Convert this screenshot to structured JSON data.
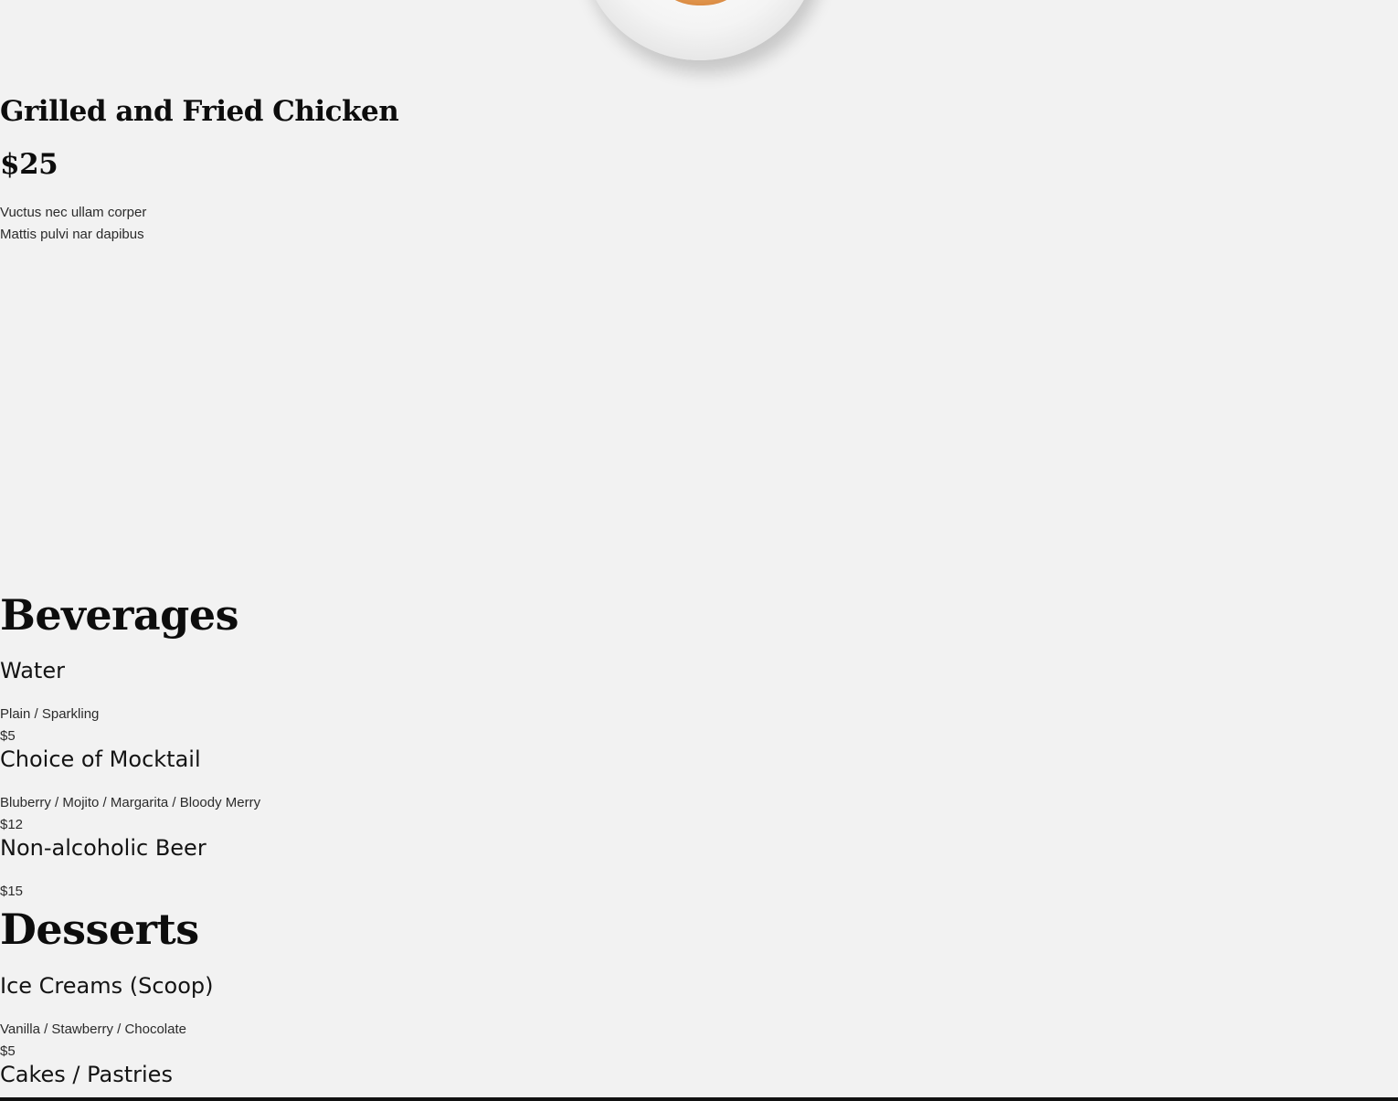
{
  "featured": {
    "image_icon": "plated-dish-image",
    "title": "Grilled and Fried Chicken",
    "price": "$25",
    "description_lines": [
      "Vuctus nec ullam corper",
      "Mattis pulvi nar dapibus"
    ]
  },
  "beverages": {
    "heading": "Beverages",
    "items": [
      {
        "name": "Water",
        "options": "Plain / Sparkling",
        "price": "$5"
      },
      {
        "name": "Choice of Mocktail",
        "options": "Bluberry / Mojito / Margarita / Bloody Merry",
        "price": "$12"
      },
      {
        "name": "Non-alcoholic Beer",
        "options": "",
        "price": "$15"
      }
    ]
  },
  "desserts": {
    "heading": "Desserts",
    "items": [
      {
        "name": "Ice Creams (Scoop)",
        "options": "Vanilla / Stawberry  / Chocolate",
        "price": "$5"
      },
      {
        "name": "Cakes / Pastries",
        "options": "",
        "price": ""
      }
    ]
  },
  "colors": {
    "background": "#f2f2f2",
    "text": "#111111",
    "bottom_bar": "#111111"
  }
}
